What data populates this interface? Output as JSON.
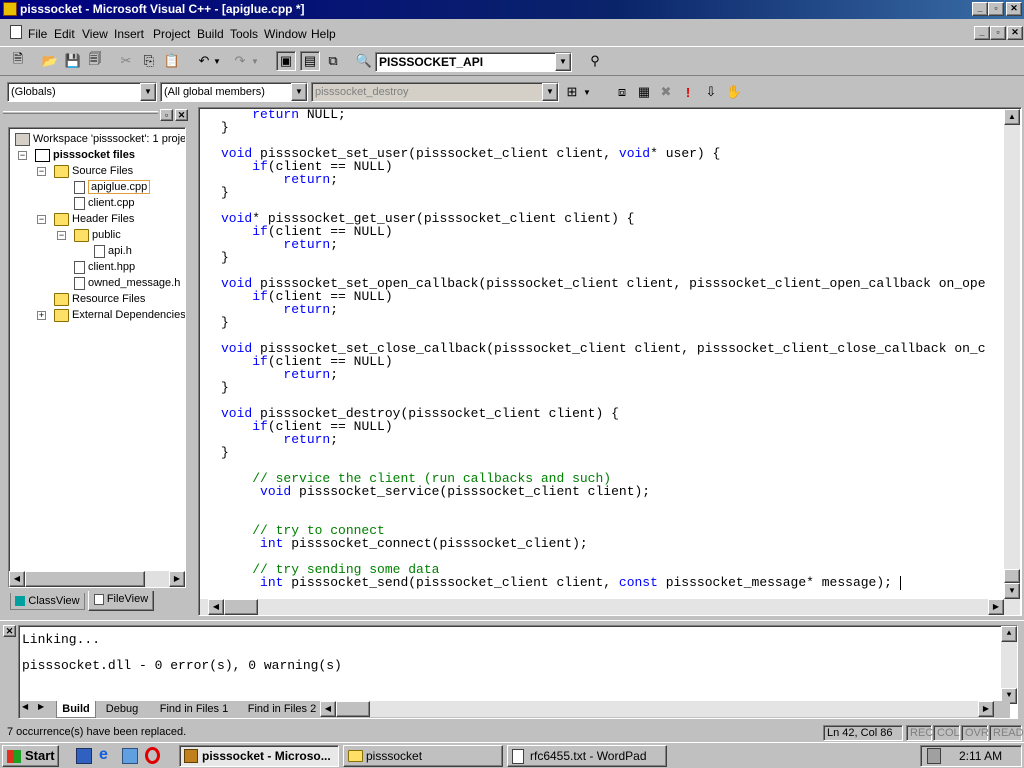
{
  "window": {
    "title": "pisssocket - Microsoft Visual C++ - [apiglue.cpp *]"
  },
  "menu": [
    "File",
    "Edit",
    "View",
    "Insert",
    "Project",
    "Build",
    "Tools",
    "Window",
    "Help"
  ],
  "toolbar": {
    "config_value": "PISSSOCKET_API"
  },
  "wizardbar": {
    "scope": "(Globals)",
    "members": "(All global members)",
    "function": "pisssocket_destroy"
  },
  "workspace": {
    "title": "Workspace 'pisssocket': 1 proje",
    "project": "pisssocket files",
    "items": [
      "Source Files",
      "apiglue.cpp",
      "client.cpp",
      "Header Files",
      "public",
      "api.h",
      "client.hpp",
      "owned_message.h",
      "Resource Files",
      "External Dependencies"
    ],
    "tabs": [
      "ClassView",
      "FileView"
    ]
  },
  "code_lines": [
    {
      "p": [
        [
          "    ",
          ""
        ],
        [
          "return",
          " kw"
        ],
        [
          " NULL;",
          ""
        ]
      ]
    },
    {
      "p": [
        [
          "}",
          ""
        ]
      ]
    },
    {
      "p": [
        [
          "",
          ""
        ]
      ]
    },
    {
      "p": [
        [
          "void",
          "kw"
        ],
        [
          " pisssocket_set_user(pisssocket_client client, ",
          ""
        ],
        [
          "void",
          "kw"
        ],
        [
          "* user) {",
          ""
        ]
      ]
    },
    {
      "p": [
        [
          "    ",
          ""
        ],
        [
          "if",
          "kw"
        ],
        [
          "(client == NULL)",
          ""
        ]
      ]
    },
    {
      "p": [
        [
          "        ",
          ""
        ],
        [
          "return",
          "kw"
        ],
        [
          ";",
          ""
        ]
      ]
    },
    {
      "p": [
        [
          "}",
          ""
        ]
      ]
    },
    {
      "p": [
        [
          "",
          ""
        ]
      ]
    },
    {
      "p": [
        [
          "void",
          "kw"
        ],
        [
          "* pisssocket_get_user(pisssocket_client client) {",
          ""
        ]
      ]
    },
    {
      "p": [
        [
          "    ",
          ""
        ],
        [
          "if",
          "kw"
        ],
        [
          "(client == NULL)",
          ""
        ]
      ]
    },
    {
      "p": [
        [
          "        ",
          ""
        ],
        [
          "return",
          "kw"
        ],
        [
          ";",
          ""
        ]
      ]
    },
    {
      "p": [
        [
          "}",
          ""
        ]
      ]
    },
    {
      "p": [
        [
          "",
          ""
        ]
      ]
    },
    {
      "p": [
        [
          "void",
          "kw"
        ],
        [
          " pisssocket_set_open_callback(pisssocket_client client, pisssocket_client_open_callback on_ope",
          ""
        ]
      ]
    },
    {
      "p": [
        [
          "    ",
          ""
        ],
        [
          "if",
          "kw"
        ],
        [
          "(client == NULL)",
          ""
        ]
      ]
    },
    {
      "p": [
        [
          "        ",
          ""
        ],
        [
          "return",
          "kw"
        ],
        [
          ";",
          ""
        ]
      ]
    },
    {
      "p": [
        [
          "}",
          ""
        ]
      ]
    },
    {
      "p": [
        [
          "",
          ""
        ]
      ]
    },
    {
      "p": [
        [
          "void",
          "kw"
        ],
        [
          " pisssocket_set_close_callback(pisssocket_client client, pisssocket_client_close_callback on_c",
          ""
        ]
      ]
    },
    {
      "p": [
        [
          "    ",
          ""
        ],
        [
          "if",
          "kw"
        ],
        [
          "(client == NULL)",
          ""
        ]
      ]
    },
    {
      "p": [
        [
          "        ",
          ""
        ],
        [
          "return",
          "kw"
        ],
        [
          ";",
          ""
        ]
      ]
    },
    {
      "p": [
        [
          "}",
          ""
        ]
      ]
    },
    {
      "p": [
        [
          "",
          ""
        ]
      ]
    },
    {
      "p": [
        [
          "void",
          "kw"
        ],
        [
          " pisssocket_destroy(pisssocket_client client) {",
          ""
        ]
      ]
    },
    {
      "p": [
        [
          "    ",
          ""
        ],
        [
          "if",
          "kw"
        ],
        [
          "(client == NULL)",
          ""
        ]
      ]
    },
    {
      "p": [
        [
          "        ",
          ""
        ],
        [
          "return",
          "kw"
        ],
        [
          ";",
          ""
        ]
      ]
    },
    {
      "p": [
        [
          "}",
          ""
        ]
      ]
    },
    {
      "p": [
        [
          "",
          ""
        ]
      ]
    },
    {
      "p": [
        [
          "    ",
          ""
        ],
        [
          "// service the client (run callbacks and such)",
          "cm"
        ]
      ]
    },
    {
      "p": [
        [
          "     ",
          ""
        ],
        [
          "void",
          "kw"
        ],
        [
          " pisssocket_service(pisssocket_client client);",
          ""
        ]
      ]
    },
    {
      "p": [
        [
          "",
          ""
        ]
      ]
    },
    {
      "p": [
        [
          "",
          ""
        ]
      ]
    },
    {
      "p": [
        [
          "    ",
          ""
        ],
        [
          "// try to connect",
          "cm"
        ]
      ]
    },
    {
      "p": [
        [
          "     ",
          ""
        ],
        [
          "int",
          "kw"
        ],
        [
          " pisssocket_connect(pisssocket_client);",
          ""
        ]
      ]
    },
    {
      "p": [
        [
          "",
          ""
        ]
      ]
    },
    {
      "p": [
        [
          "    ",
          ""
        ],
        [
          "// try sending some data",
          "cm"
        ]
      ]
    },
    {
      "p": [
        [
          "     ",
          ""
        ],
        [
          "int",
          "kw"
        ],
        [
          " pisssocket_send(pisssocket_client client, ",
          ""
        ],
        [
          "const",
          "kw"
        ],
        [
          " pisssocket_message* message);",
          ""
        ]
      ]
    }
  ],
  "output": {
    "line1": "Linking...",
    "line2": "pisssocket.dll - 0 error(s), 0 warning(s)",
    "tabs": [
      "Build",
      "Debug",
      "Find in Files 1",
      "Find in Files 2"
    ]
  },
  "statusbar": {
    "message": "7 occurrence(s) have been replaced.",
    "position": "Ln 42, Col 86",
    "indicators": [
      "REC",
      "COL",
      "OVR",
      "READ"
    ]
  },
  "taskbar": {
    "start": "Start",
    "buttons": [
      "pisssocket - Microso...",
      "pisssocket",
      "rfc6455.txt - WordPad"
    ],
    "clock": "2:11 AM"
  }
}
